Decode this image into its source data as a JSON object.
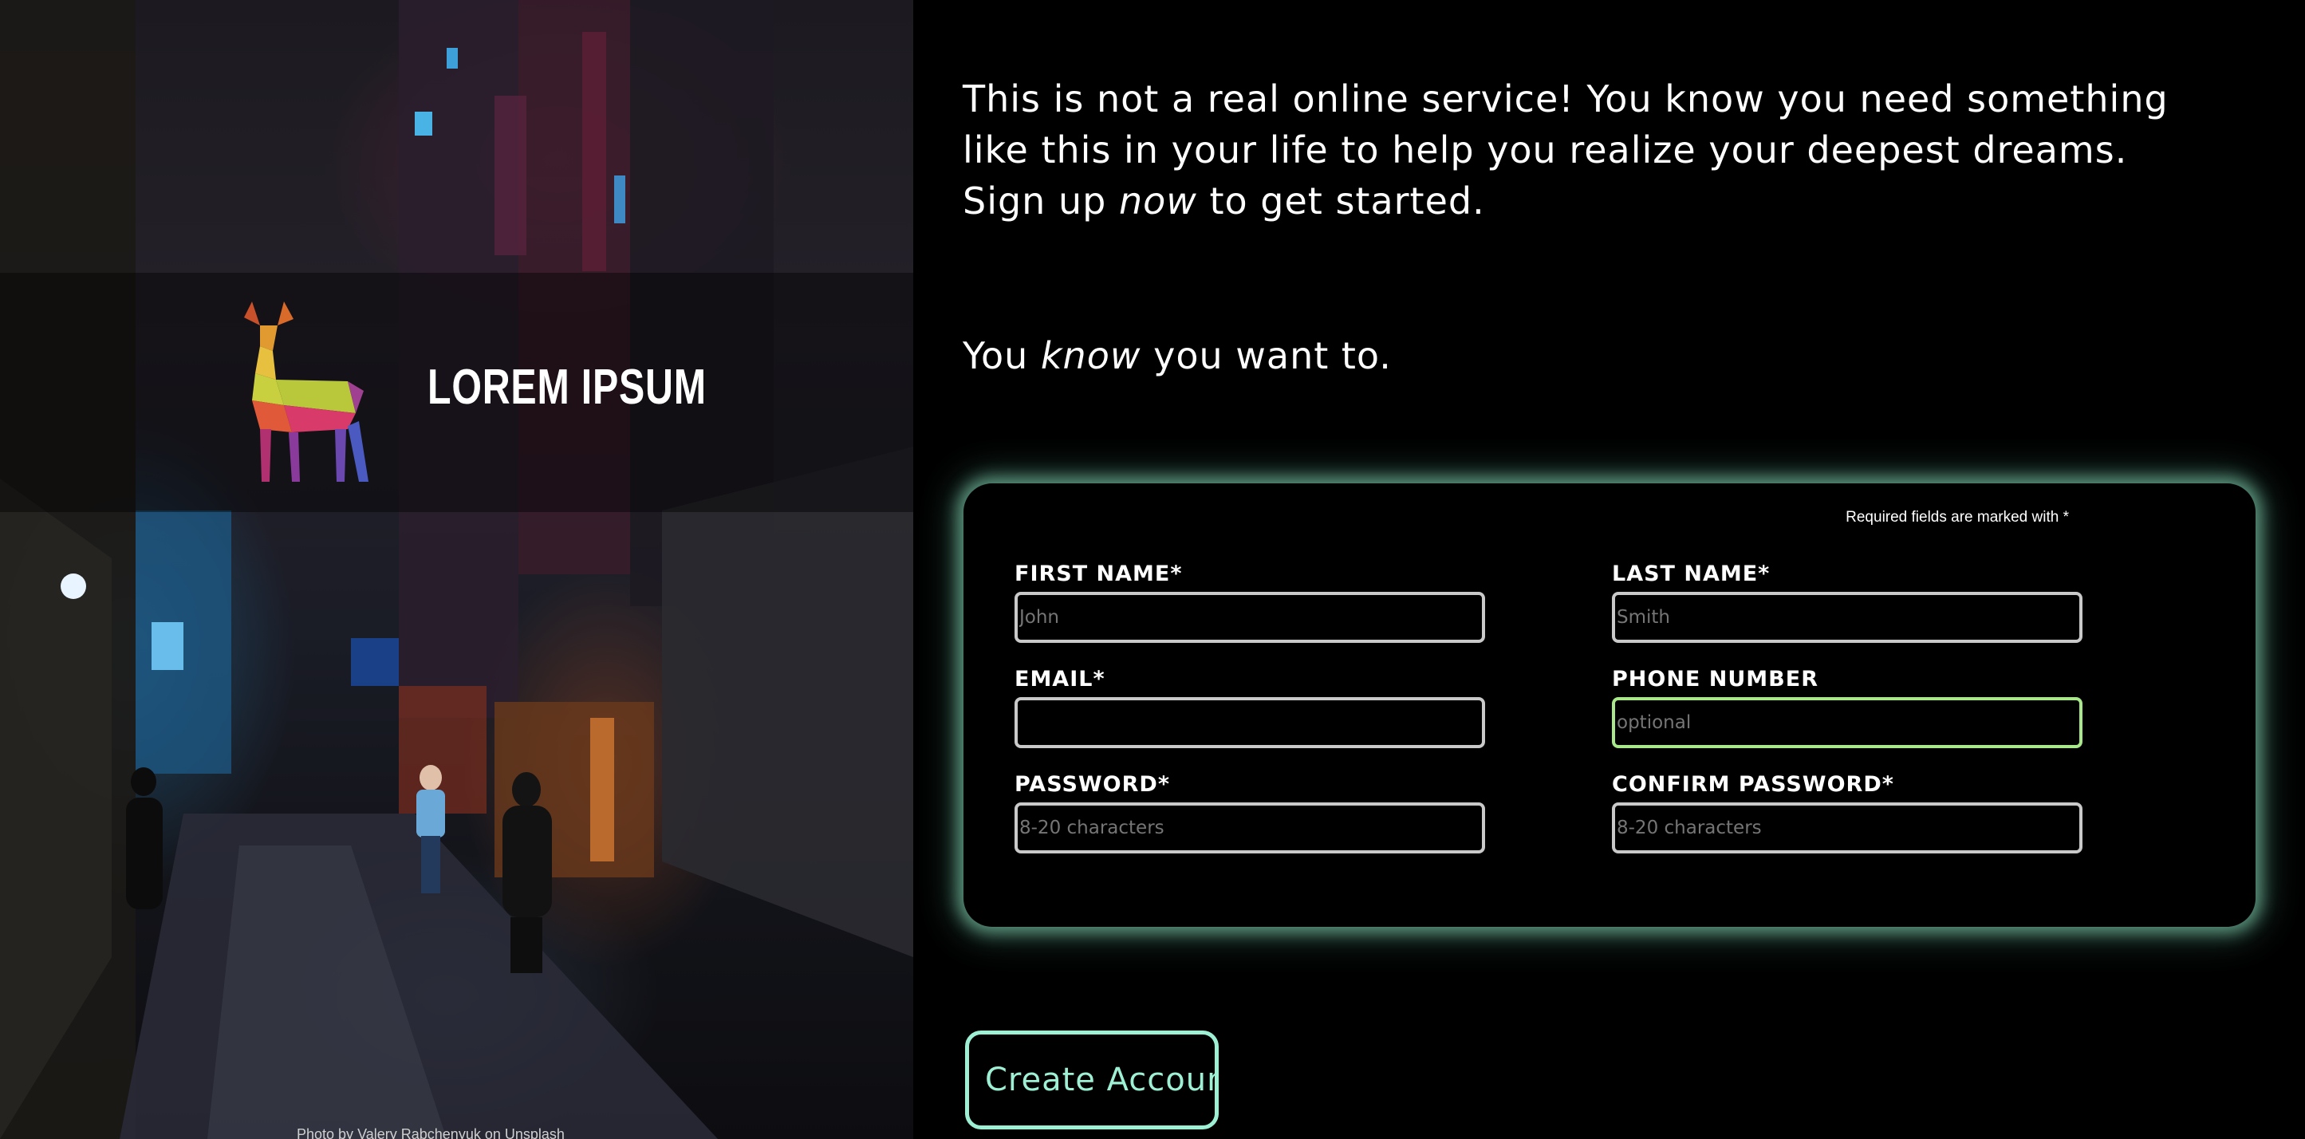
{
  "brand": {
    "logo_text": "LOREM IPSUM",
    "logo_icon": "polygon-deer-icon"
  },
  "photo_credit": {
    "prefix": "Photo by",
    "author": "Valery Rabchenyuk",
    "middle": "on",
    "source": "Unsplash"
  },
  "intro": {
    "line_pre": "This is not a real online service! You know you need something like this in your life to help you realize your deepest dreams. Sign up",
    "emphasis": "now",
    "line_post": "to get started."
  },
  "tagline": {
    "pre": "You",
    "emphasis": "know",
    "post": "you want to."
  },
  "form": {
    "required_note": "Required fields are marked with *",
    "fields": {
      "first_name": {
        "label": "FIRST NAME*",
        "placeholder": "John"
      },
      "last_name": {
        "label": "LAST NAME*",
        "placeholder": "Smith"
      },
      "email": {
        "label": "EMAIL*",
        "placeholder": ""
      },
      "phone": {
        "label": "PHONE NUMBER",
        "placeholder": "optional"
      },
      "password": {
        "label": "PASSWORD*",
        "placeholder": "8-20 characters"
      },
      "confirm_password": {
        "label": "CONFIRM PASSWORD*",
        "placeholder": "8-20 characters"
      }
    }
  },
  "submit": {
    "label": "Create Account"
  },
  "colors": {
    "accent": "#9ef0d4",
    "focus_border": "#a8e88a",
    "background": "#000000"
  }
}
